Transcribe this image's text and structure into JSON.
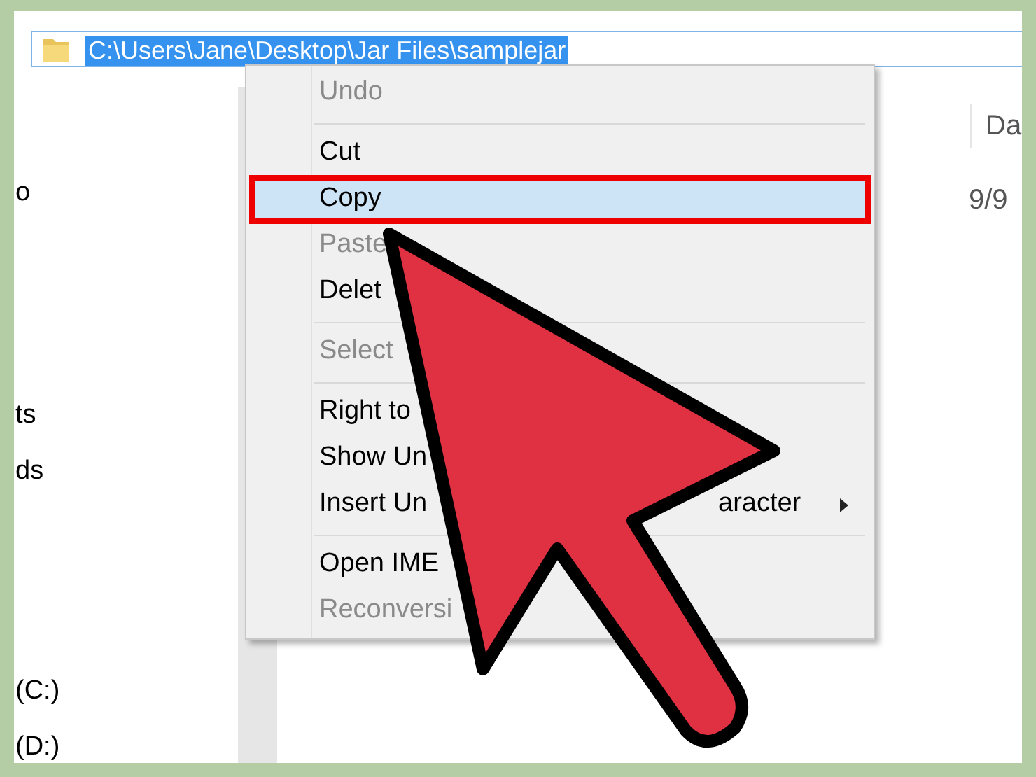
{
  "address_bar": {
    "path": "C:\\Users\\Jane\\Desktop\\Jar Files\\samplejar",
    "selected": true
  },
  "sidebar": {
    "items": [
      "o",
      "ts",
      "ds",
      "(C:)",
      "(D:)"
    ]
  },
  "file_list": {
    "column_1": "Da",
    "cell_1": "9/9"
  },
  "context_menu": {
    "items": [
      {
        "kind": "item",
        "label": "Undo",
        "disabled": true,
        "selected": false
      },
      {
        "kind": "separator"
      },
      {
        "kind": "item",
        "label": "Cut",
        "disabled": false,
        "selected": false
      },
      {
        "kind": "item",
        "label": "Copy",
        "disabled": false,
        "selected": true,
        "outlined": true
      },
      {
        "kind": "item",
        "label": "Paste",
        "disabled": true,
        "selected": false
      },
      {
        "kind": "item",
        "label": "Delet",
        "disabled": false,
        "selected": false
      },
      {
        "kind": "separator"
      },
      {
        "kind": "item",
        "label": "Select",
        "disabled": true,
        "selected": false
      },
      {
        "kind": "separator"
      },
      {
        "kind": "item",
        "label": "Right to",
        "disabled": false,
        "selected": false
      },
      {
        "kind": "item",
        "label": "Show Un",
        "disabled": false,
        "selected": false
      },
      {
        "kind": "item",
        "label": "Insert Un",
        "tail": "aracter",
        "submenu": true,
        "disabled": false,
        "selected": false
      },
      {
        "kind": "separator"
      },
      {
        "kind": "item",
        "label": "Open IME",
        "disabled": false,
        "selected": false
      },
      {
        "kind": "item",
        "label": "Reconversi",
        "disabled": true,
        "selected": false
      }
    ]
  }
}
